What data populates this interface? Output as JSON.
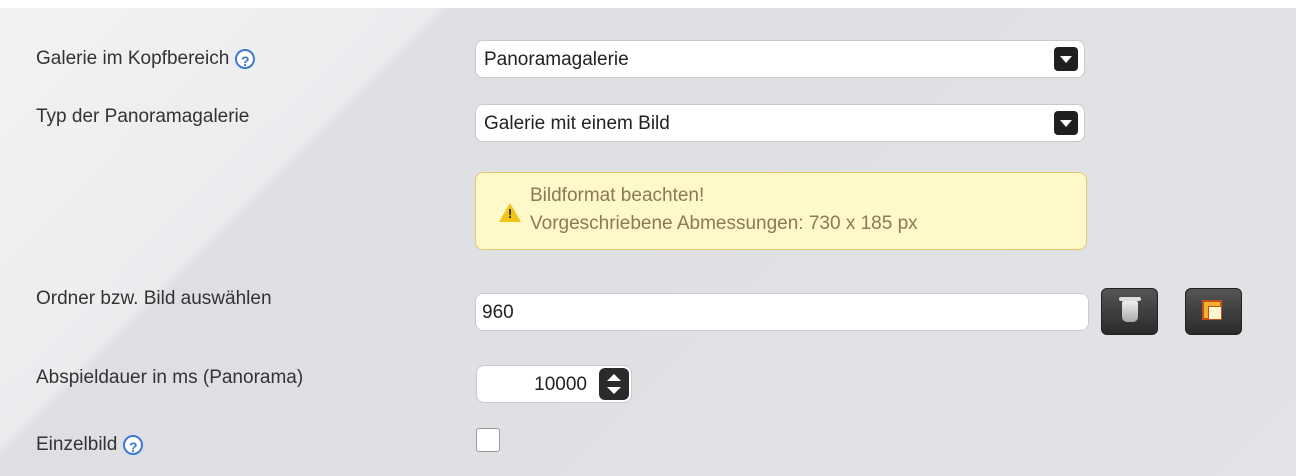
{
  "form": {
    "galerie": {
      "label": "Galerie im Kopfbereich",
      "help": "?",
      "value": "Panoramagalerie"
    },
    "typ": {
      "label": "Typ der Panoramagalerie",
      "value": "Galerie mit einem Bild"
    },
    "warning": {
      "title": "Bildformat beachten!",
      "text": "Vorgeschriebene Abmessungen: 730 x 185 px",
      "icon": "warning-icon",
      "color": "#fff8c9"
    },
    "ordner": {
      "label": "Ordner bzw. Bild auswählen",
      "value": "960",
      "delete_icon": "trash-icon",
      "browse_icon": "folder-browse-icon"
    },
    "abspieldauer": {
      "label": "Abspieldauer in ms (Panorama)",
      "value": "10000"
    },
    "einzelbild": {
      "label": "Einzelbild",
      "help": "?",
      "checked": false
    }
  }
}
